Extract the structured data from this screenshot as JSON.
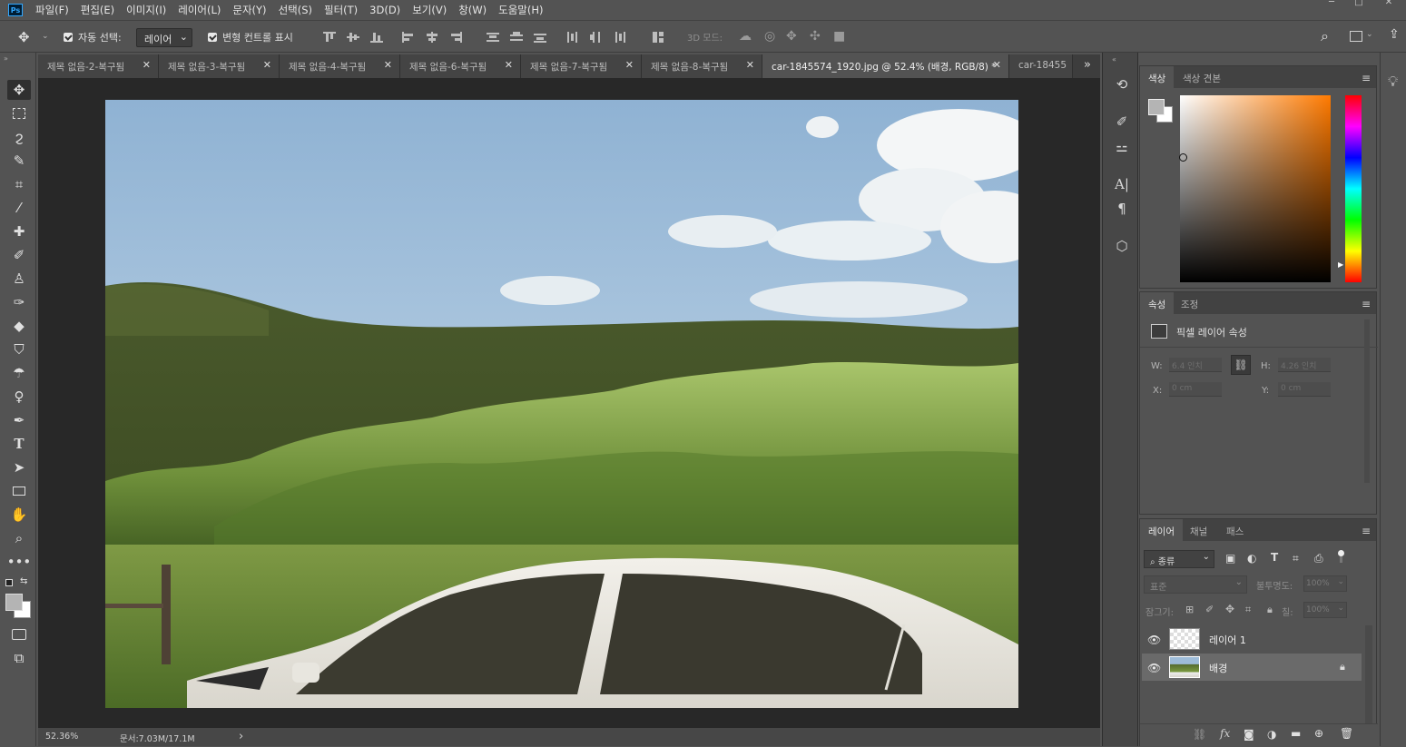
{
  "app": {
    "logo": "Ps",
    "title_bar_controls": [
      "─",
      "□",
      "✕"
    ]
  },
  "menu": [
    "파일(F)",
    "편집(E)",
    "이미지(I)",
    "레이어(L)",
    "문자(Y)",
    "선택(S)",
    "필터(T)",
    "3D(D)",
    "보기(V)",
    "창(W)",
    "도움말(H)"
  ],
  "options": {
    "move_icon": "move-icon",
    "auto_select_label": "자동 선택:",
    "auto_select_value": "레이어",
    "transform_label": "변형 컨트롤 표시",
    "mode_3d_label": "3D 모드:"
  },
  "tabs": [
    {
      "label": "제목 없음-2-복구됨",
      "close": "✕"
    },
    {
      "label": "제목 없음-3-복구됨",
      "close": "✕"
    },
    {
      "label": "제목 없음-4-복구됨",
      "close": "✕"
    },
    {
      "label": "제목 없음-6-복구됨",
      "close": "✕"
    },
    {
      "label": "제목 없음-7-복구됨",
      "close": "✕"
    },
    {
      "label": "제목 없음-8-복구됨",
      "close": "✕"
    },
    {
      "label": "car-1845574_1920.jpg @ 52.4% (배경, RGB/8) *",
      "close": "✕",
      "active": true
    },
    {
      "label": "car-18455",
      "close": ""
    }
  ],
  "tab_overflow": "»",
  "status": {
    "zoom": "52.36%",
    "doc_info": "문서:7.03M/17.1M",
    "arrow": "›"
  },
  "tools": [
    "move-tool",
    "marquee-tool",
    "lasso-tool",
    "quick-select-tool",
    "crop-tool",
    "eyedropper-tool",
    "healing-brush-tool",
    "brush-tool",
    "clone-stamp-tool",
    "history-brush-tool",
    "eraser-tool",
    "paint-bucket-tool",
    "blur-tool",
    "dodge-tool",
    "pen-tool",
    "type-tool",
    "path-select-tool",
    "rectangle-tool",
    "hand-tool",
    "zoom-tool",
    "more-tools"
  ],
  "colors": {
    "foreground": "#b4b4b4",
    "background": "#ffffff",
    "accent": "#31a8ff"
  },
  "color_panel": {
    "tabs": [
      "색상",
      "색상 견본"
    ],
    "hue_swatch": "#ff7a00"
  },
  "properties_panel": {
    "tabs": [
      "속성",
      "조정"
    ],
    "heading": "픽셀 레이어 속성",
    "w_label": "W:",
    "w_value": "6.4 인치",
    "h_label": "H:",
    "h_value": "4.26 인치",
    "x_label": "X:",
    "x_value": "0 cm",
    "y_label": "Y:",
    "y_value": "0 cm"
  },
  "layers_panel": {
    "tabs": [
      "레이어",
      "채널",
      "패스"
    ],
    "filter_label": "⌕ 종류",
    "blend_mode": "표준",
    "opacity_label": "불투명도:",
    "opacity_value": "100%",
    "lock_label": "잠그기:",
    "fill_label": "칠:",
    "fill_value": "100%",
    "layers": [
      {
        "name": "레이어 1",
        "visible": true,
        "selected": false
      },
      {
        "name": "배경",
        "visible": true,
        "selected": true,
        "locked": true
      }
    ],
    "footer_icons": [
      "link-icon",
      "fx-icon",
      "mask-icon",
      "adjustment-icon",
      "group-icon",
      "new-layer-icon",
      "delete-icon"
    ]
  }
}
